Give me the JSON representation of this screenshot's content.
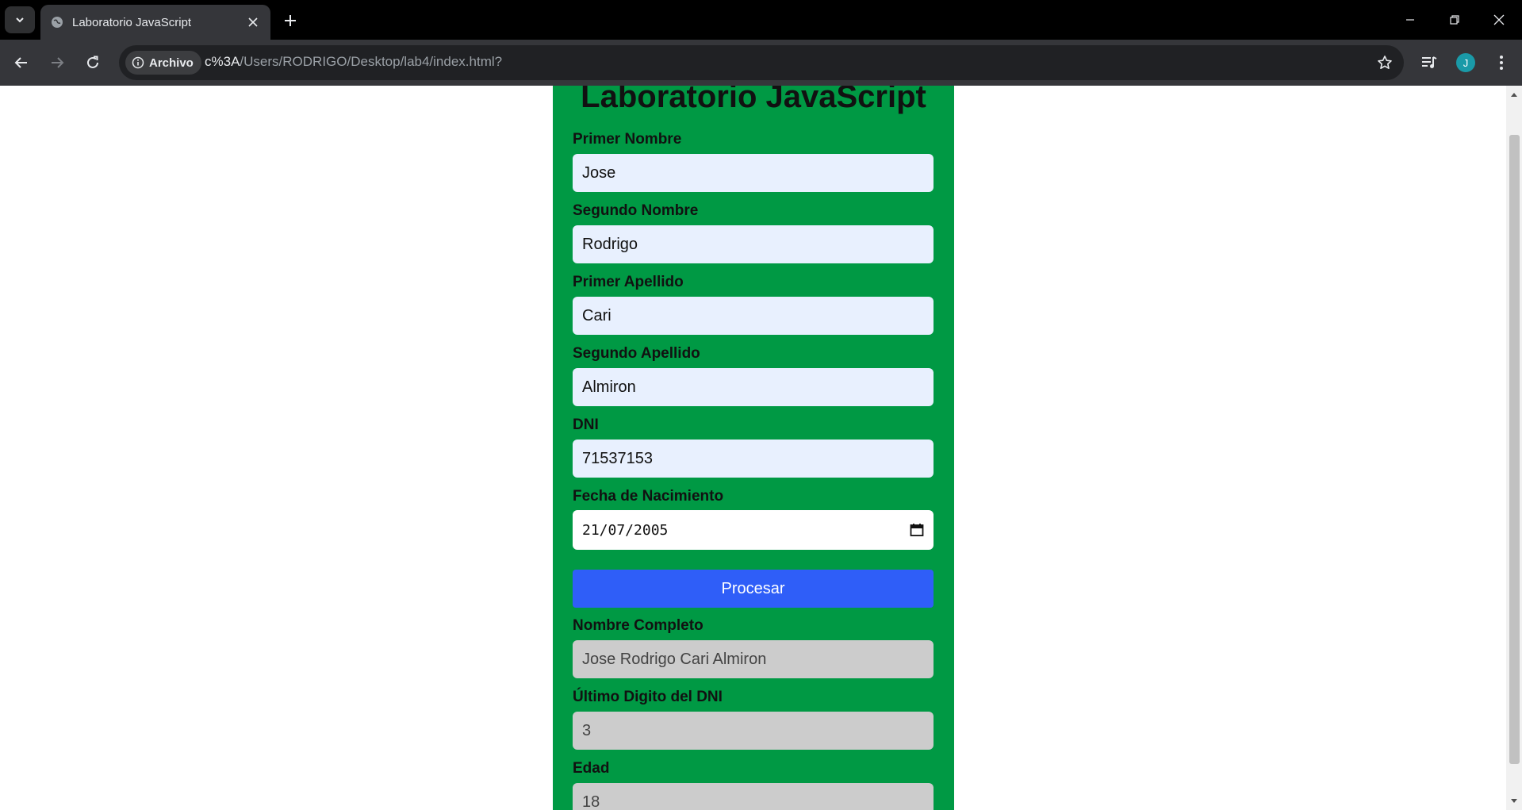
{
  "browser": {
    "tab_title": "Laboratorio JavaScript",
    "info_chip_label": "Archivo",
    "url_host": "c%3A",
    "url_path": "/Users/RODRIGO/Desktop/lab4/index.html?",
    "profile_initial": "J",
    "icons": {
      "tab_search": "chevron-down-icon",
      "favicon": "globe-icon",
      "close": "close-icon",
      "new_tab": "plus-icon",
      "back": "arrow-left-icon",
      "forward": "arrow-right-icon",
      "reload": "reload-icon",
      "info": "info-icon",
      "bookmark": "star-icon",
      "media": "media-queue-icon",
      "menu": "kebab-menu-icon"
    }
  },
  "page": {
    "title": "Laboratorio JavaScript",
    "fields": [
      {
        "label": "Primer Nombre",
        "value": "Jose"
      },
      {
        "label": "Segundo Nombre",
        "value": "Rodrigo"
      },
      {
        "label": "Primer Apellido",
        "value": "Cari"
      },
      {
        "label": "Segundo Apellido",
        "value": "Almiron"
      },
      {
        "label": "DNI",
        "value": "71537153"
      },
      {
        "label": "Fecha de Nacimiento",
        "value": "21/07/2005"
      }
    ],
    "submit_label": "Procesar",
    "results": [
      {
        "label": "Nombre Completo",
        "value": "Jose Rodrigo Cari Almiron"
      },
      {
        "label": "Último Digito del DNI",
        "value": "3"
      },
      {
        "label": "Edad",
        "value": "18"
      }
    ]
  },
  "colors": {
    "card": "#009944",
    "input_bg": "#e8f0fe",
    "readonly_bg": "#cccccc",
    "button": "#2f5ef8",
    "chrome_dark": "#35363a"
  }
}
